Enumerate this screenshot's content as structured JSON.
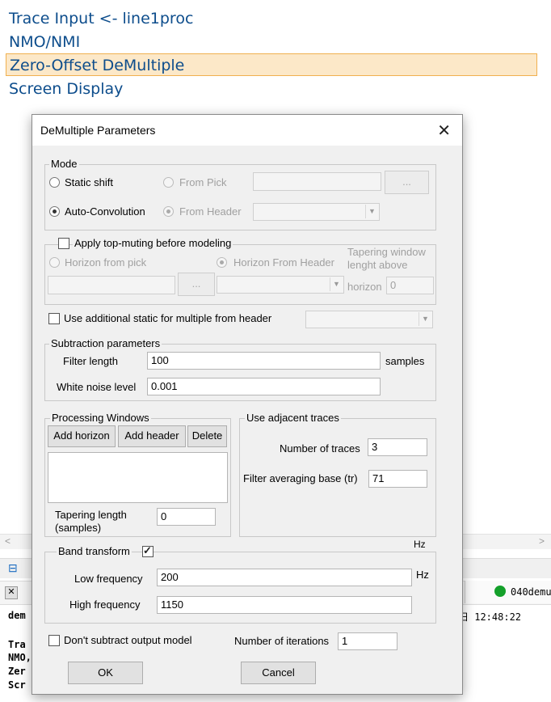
{
  "flow": {
    "items": [
      {
        "label": "Trace Input <- line1proc"
      },
      {
        "label": "NMO/NMI"
      },
      {
        "label": "Zero-Offset DeMultiple"
      },
      {
        "label": "Screen Display"
      }
    ],
    "scroll_left": "<",
    "scroll_right": ">"
  },
  "status": {
    "process_name": "040demu",
    "time": "日 12:48:22"
  },
  "log": {
    "line0": "dem",
    "lines": [
      "Tra",
      "NMO,",
      "Zer",
      "Scr"
    ]
  },
  "dialog": {
    "title": "DeMultiple Parameters",
    "close": "✕",
    "mode": {
      "legend": "Mode",
      "static_shift": "Static shift",
      "auto_convolution": "Auto-Convolution",
      "from_pick": "From Pick",
      "from_header": "From Header",
      "browse": "...",
      "selected": "auto_convolution"
    },
    "muting": {
      "legend": "Apply top-muting before modeling",
      "checked": false,
      "horizon_from_pick": "Horizon from pick",
      "horizon_from_header": "Horizon From Header",
      "taper_label_1": "Tapering window",
      "taper_label_2": "lenght above",
      "taper_label_3": "horizon",
      "taper_value": "0",
      "browse": "..."
    },
    "additional_static": {
      "label": "Use additional static for multiple from header",
      "checked": false
    },
    "subtraction": {
      "legend": "Subtraction parameters",
      "filter_length_label": "Filter length",
      "filter_length": "100",
      "samples_unit": "samples",
      "white_noise_label": "White noise level",
      "white_noise": "0.001"
    },
    "processing_windows": {
      "legend": "Processing Windows",
      "add_horizon": "Add horizon",
      "add_header": "Add header",
      "delete": "Delete",
      "tapering_label_1": "Tapering length",
      "tapering_label_2": "(samples)",
      "tapering_value": "0"
    },
    "adjacent": {
      "legend": "Use adjacent traces",
      "num_traces_label": "Number of traces",
      "num_traces": "3",
      "filter_avg_label": "Filter averaging base (tr)",
      "filter_avg": "71"
    },
    "band": {
      "legend": "Band transform",
      "checked": true,
      "hz_top": "Hz",
      "low_label": "Low frequency",
      "low_value": "200",
      "hz_unit": "Hz",
      "high_label": "High frequency",
      "high_value": "1150"
    },
    "dont_subtract": {
      "label": "Don't subtract output model",
      "checked": false
    },
    "iterations": {
      "label": "Number of iterations",
      "value": "1"
    },
    "ok": "OK",
    "cancel": "Cancel"
  }
}
